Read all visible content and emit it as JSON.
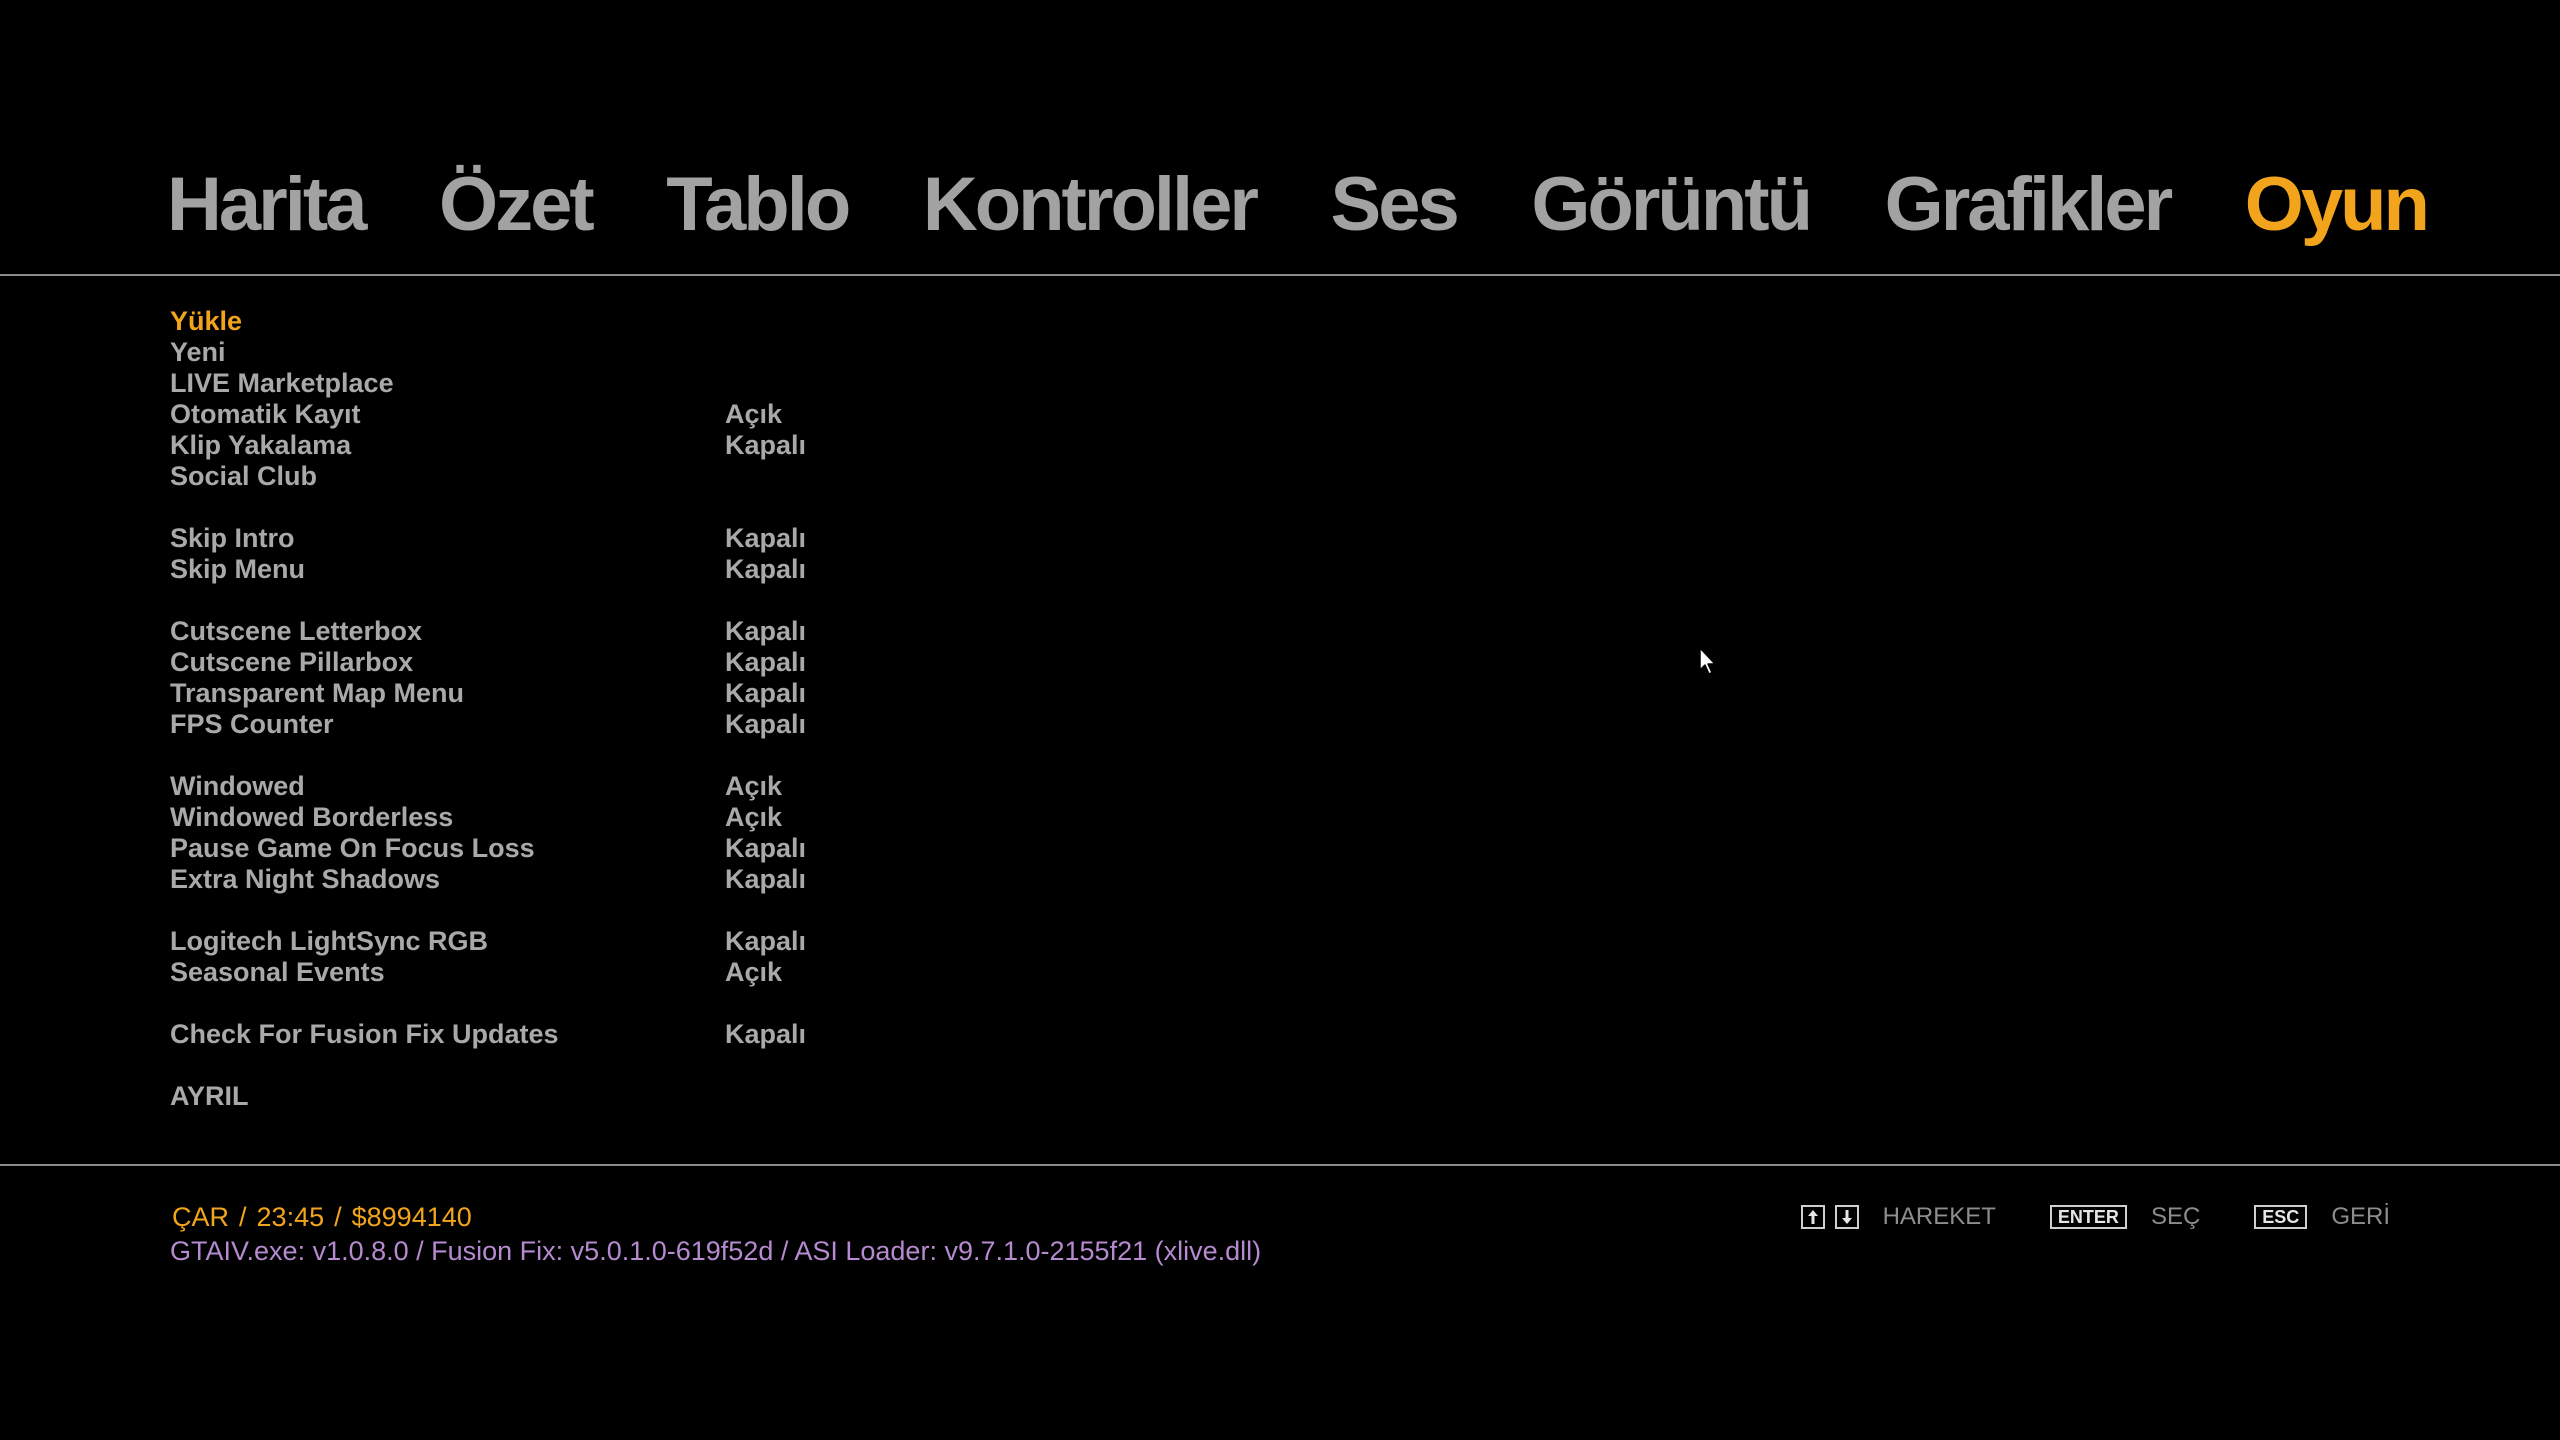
{
  "tabs": [
    {
      "label": "Harita",
      "active": false
    },
    {
      "label": "Özet",
      "active": false
    },
    {
      "label": "Tablo",
      "active": false
    },
    {
      "label": "Kontroller",
      "active": false
    },
    {
      "label": "Ses",
      "active": false
    },
    {
      "label": "Görüntü",
      "active": false
    },
    {
      "label": "Grafikler",
      "active": false
    },
    {
      "label": "Oyun",
      "active": true
    }
  ],
  "menu": {
    "load": "Yükle",
    "new": "Yeni",
    "marketplace": "LIVE Marketplace",
    "autosave": {
      "label": "Otomatik Kayıt",
      "value": "Açık"
    },
    "clip_capture": {
      "label": "Klip Yakalama",
      "value": "Kapalı"
    },
    "social_club": "Social Club",
    "skip_intro": {
      "label": "Skip Intro",
      "value": "Kapalı"
    },
    "skip_menu": {
      "label": "Skip Menu",
      "value": "Kapalı"
    },
    "cutscene_letterbox": {
      "label": "Cutscene Letterbox",
      "value": "Kapalı"
    },
    "cutscene_pillarbox": {
      "label": "Cutscene Pillarbox",
      "value": "Kapalı"
    },
    "transparent_map_menu": {
      "label": "Transparent Map Menu",
      "value": "Kapalı"
    },
    "fps_counter": {
      "label": "FPS Counter",
      "value": "Kapalı"
    },
    "windowed": {
      "label": "Windowed",
      "value": "Açık"
    },
    "windowed_borderless": {
      "label": "Windowed Borderless",
      "value": "Açık"
    },
    "pause_on_focus_loss": {
      "label": "Pause Game On Focus Loss",
      "value": "Kapalı"
    },
    "extra_night_shadows": {
      "label": "Extra Night Shadows",
      "value": "Kapalı"
    },
    "logitech_rgb": {
      "label": "Logitech LightSync RGB",
      "value": "Kapalı"
    },
    "seasonal_events": {
      "label": "Seasonal Events",
      "value": "Açık"
    },
    "fusion_fix_updates": {
      "label": "Check For Fusion Fix Updates",
      "value": "Kapalı"
    },
    "quit": "AYRIL"
  },
  "status": {
    "day": "ÇAR",
    "time": "23:45",
    "money": "$8994140",
    "separator": "/"
  },
  "version": "GTAIV.exe: v1.0.8.0 / Fusion Fix: v5.0.1.0-619f52d / ASI Loader: v9.7.1.0-2155f21 (xlive.dll)",
  "hints": {
    "move_label": "HAREKET",
    "enter_key": "ENTER",
    "select_label": "SEÇ",
    "esc_key": "ESC",
    "back_label": "GERİ"
  },
  "colors": {
    "accent": "#f2a41c",
    "text": "#a9a9a9",
    "version": "#b58ad0",
    "background": "#000000"
  }
}
